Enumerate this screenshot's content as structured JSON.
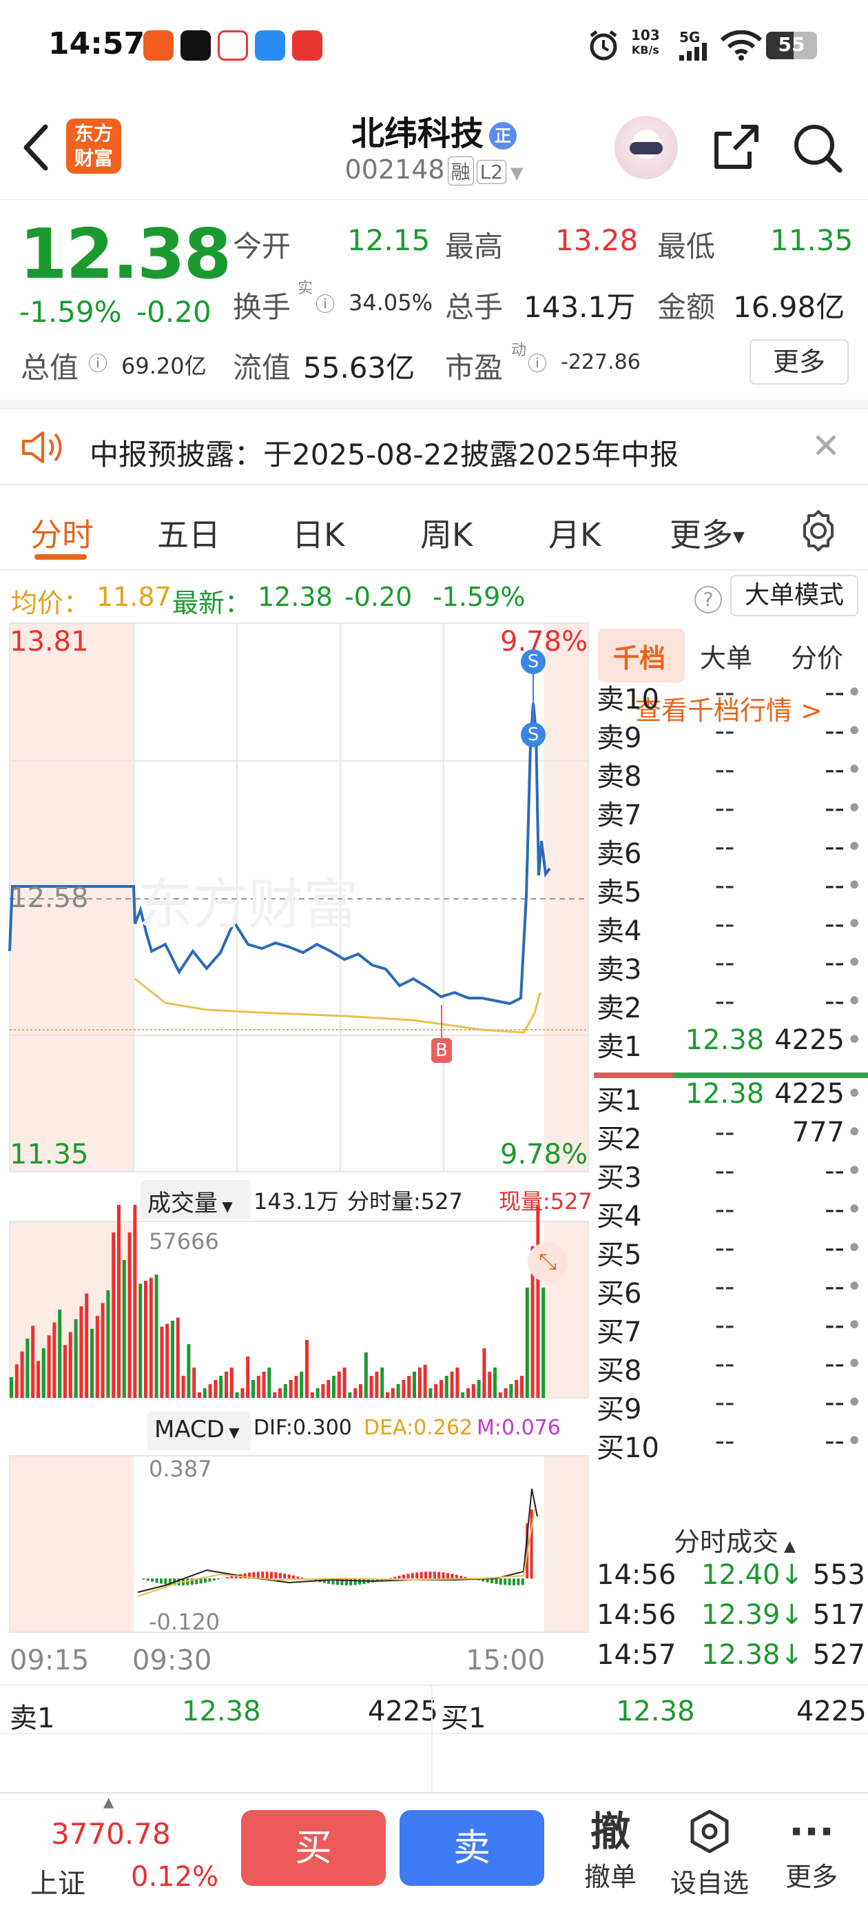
{
  "status_bar": {
    "time": "14:57",
    "net_speed_value": "103",
    "net_speed_unit": "KB/s",
    "network": "5G",
    "battery": "55"
  },
  "header": {
    "logo_line1": "东方",
    "logo_line2": "财富",
    "name": "北纬科技",
    "name_badge": "正",
    "code": "002148",
    "tag_margin": "融",
    "tag_level": "L2"
  },
  "quote": {
    "price": "12.38",
    "change_pct": "-1.59%",
    "change": "-0.20",
    "open_label": "今开",
    "open": "12.15",
    "high_label": "最高",
    "high": "13.28",
    "low_label": "最低",
    "low": "11.35",
    "turnover_label": "换手",
    "turnover_sup": "实",
    "turnover": "34.05%",
    "volume_label": "总手",
    "volume": "143.1万",
    "amount_label": "金额",
    "amount": "16.98亿",
    "mktcap_label": "总值",
    "mktcap": "69.20亿",
    "float_label": "流值",
    "float": "55.63亿",
    "pe_label": "市盈",
    "pe_sup": "动",
    "pe": "-227.86",
    "more": "更多"
  },
  "notice": {
    "text": "中报预披露：于2025-08-22披露2025年中报"
  },
  "tabs": [
    "分时",
    "五日",
    "日K",
    "周K",
    "月K",
    "更多"
  ],
  "info_bar": {
    "avg_label": "均价：",
    "avg": "11.87",
    "latest_label": "最新：",
    "latest": "12.38",
    "change": "-0.20",
    "change_pct": "-1.59%",
    "big_order": "大单模式"
  },
  "chart": {
    "y_max": "13.81",
    "y_mid": "12.58",
    "y_min": "11.35",
    "pct_top": "9.78%",
    "pct_bottom": "9.78%",
    "vol_label": "成交量",
    "vol_total": "143.1万",
    "vol_tick": "分时量:527",
    "vol_now": "现量:527",
    "vol_max": "57666",
    "macd_label": "MACD",
    "dif": "DIF:0.300",
    "dea": "DEA:0.262",
    "m": "M:0.076",
    "macd_max": "0.387",
    "macd_min": "-0.120",
    "t_start": "09:15",
    "t_open": "09:30",
    "t_end": "15:00",
    "marker_b": "B",
    "marker_s": "S"
  },
  "side_panel": {
    "tabs": [
      "千档",
      "大单",
      "分价"
    ],
    "link": "查看千档行情 >",
    "asks": [
      {
        "n": "卖10",
        "p": "--",
        "v": "--"
      },
      {
        "n": "卖9",
        "p": "--",
        "v": "--"
      },
      {
        "n": "卖8",
        "p": "--",
        "v": "--"
      },
      {
        "n": "卖7",
        "p": "--",
        "v": "--"
      },
      {
        "n": "卖6",
        "p": "--",
        "v": "--"
      },
      {
        "n": "卖5",
        "p": "--",
        "v": "--"
      },
      {
        "n": "卖4",
        "p": "--",
        "v": "--"
      },
      {
        "n": "卖3",
        "p": "--",
        "v": "--"
      },
      {
        "n": "卖2",
        "p": "--",
        "v": "--"
      },
      {
        "n": "卖1",
        "p": "12.38",
        "v": "4225"
      }
    ],
    "bids": [
      {
        "n": "买1",
        "p": "12.38",
        "v": "4225"
      },
      {
        "n": "买2",
        "p": "--",
        "v": "777"
      },
      {
        "n": "买3",
        "p": "--",
        "v": "--"
      },
      {
        "n": "买4",
        "p": "--",
        "v": "--"
      },
      {
        "n": "买5",
        "p": "--",
        "v": "--"
      },
      {
        "n": "买6",
        "p": "--",
        "v": "--"
      },
      {
        "n": "买7",
        "p": "--",
        "v": "--"
      },
      {
        "n": "买8",
        "p": "--",
        "v": "--"
      },
      {
        "n": "买9",
        "p": "--",
        "v": "--"
      },
      {
        "n": "买10",
        "p": "--",
        "v": "--"
      }
    ],
    "trades_title": "分时成交",
    "trades": [
      {
        "t": "14:56",
        "p": "12.40↓",
        "v": "553"
      },
      {
        "t": "14:56",
        "p": "12.39↓",
        "v": "517"
      },
      {
        "t": "14:57",
        "p": "12.38↓",
        "v": "527"
      }
    ]
  },
  "level1": {
    "ask_label": "卖1",
    "ask_price": "12.38",
    "ask_vol": "4225",
    "bid_label": "买1",
    "bid_price": "12.38",
    "bid_vol": "4225"
  },
  "bottom": {
    "index_value": "3770.78",
    "index_name": "上证",
    "index_pct": "0.12%",
    "buy": "买",
    "sell": "卖",
    "cancel_icon": "撤",
    "cancel": "撤单",
    "watchlist": "设自选",
    "more": "更多"
  }
}
